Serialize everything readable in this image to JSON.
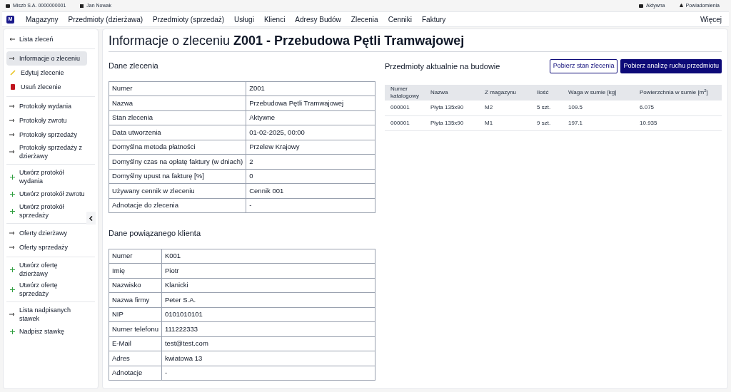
{
  "top_bar": {
    "company": "Miszb S.A. 0000000001",
    "user": "Jan Nowak",
    "status": "Aktywna",
    "notifications": "Powiadomienia"
  },
  "nav": {
    "logo": "M",
    "items": [
      "Magazyny",
      "Przedmioty (dzierżawa)",
      "Przedmioty (sprzedaż)",
      "Usługi",
      "Klienci",
      "Adresy Budów",
      "Zlecenia",
      "Cenniki",
      "Faktury"
    ],
    "more": "Więcej"
  },
  "sidebar": {
    "groups": [
      [
        {
          "kind": "back",
          "label": "Lista zleceń",
          "selected": false
        }
      ],
      [
        {
          "kind": "link",
          "label": "Informacje o zleceniu",
          "selected": true
        },
        {
          "kind": "edit",
          "label": "Edytuj zlecenie",
          "selected": false
        },
        {
          "kind": "delete",
          "label": "Usuń zlecenie",
          "selected": false
        }
      ],
      [
        {
          "kind": "link",
          "label": "Protokoły wydania",
          "selected": false
        },
        {
          "kind": "link",
          "label": "Protokoły zwrotu",
          "selected": false
        },
        {
          "kind": "link",
          "label": "Protokoły sprzedaży",
          "selected": false
        },
        {
          "kind": "link",
          "label": "Protokoły sprzedaży z dzierżawy",
          "selected": false
        }
      ],
      [
        {
          "kind": "add",
          "label": "Utwórz protokół wydania",
          "selected": false
        },
        {
          "kind": "add",
          "label": "Utwórz protokół zwrotu",
          "selected": false
        },
        {
          "kind": "add",
          "label": "Utwórz protokół sprzedaży",
          "selected": false
        }
      ],
      [
        {
          "kind": "link",
          "label": "Oferty dzierżawy",
          "selected": false
        },
        {
          "kind": "link",
          "label": "Oferty sprzedaży",
          "selected": false
        }
      ],
      [
        {
          "kind": "add",
          "label": "Utwórz ofertę dzierżawy",
          "selected": false
        },
        {
          "kind": "add",
          "label": "Utwórz ofertę sprzedaży",
          "selected": false
        }
      ],
      [
        {
          "kind": "link",
          "label": "Lista nadpisanych stawek",
          "selected": false
        },
        {
          "kind": "add",
          "label": "Nadpisz stawkę",
          "selected": false
        }
      ]
    ]
  },
  "title": {
    "prefix": "Informacje o zleceniu ",
    "code": "Z001 - Przebudowa Pętli Tramwajowej"
  },
  "order": {
    "heading": "Dane zlecenia",
    "rows": [
      [
        "Numer",
        "Z001"
      ],
      [
        "Nazwa",
        "Przebudowa Pętli Tramwajowej"
      ],
      [
        "Stan zlecenia",
        "Aktywne"
      ],
      [
        "Data utworzenia",
        "01-02-2025, 00:00"
      ],
      [
        "Domyślna metoda płatności",
        "Przelew Krajowy"
      ],
      [
        "Domyślny czas na opłatę faktury (w dniach)",
        "2"
      ],
      [
        "Domyślny upust na fakturę [%]",
        "0"
      ],
      [
        "Używany cennik w zleceniu",
        "Cennik 001"
      ],
      [
        "Adnotacje do zlecenia",
        "-"
      ]
    ]
  },
  "client": {
    "heading": "Dane powiązanego klienta",
    "rows": [
      [
        "Numer",
        "K001"
      ],
      [
        "Imię",
        "Piotr"
      ],
      [
        "Nazwisko",
        "Klanicki"
      ],
      [
        "Nazwa firmy",
        "Peter S.A."
      ],
      [
        "NIP",
        "0101010101"
      ],
      [
        "Numer telefonu",
        "111222333"
      ],
      [
        "E-Mail",
        "test@test.com"
      ],
      [
        "Adres",
        "kwiatowa 13"
      ],
      [
        "Adnotacje",
        "-"
      ]
    ]
  },
  "items": {
    "heading": "Przedmioty aktualnie na budowie",
    "buttons": [
      {
        "label": "Pobierz stan zlecenia",
        "kind": "outline"
      },
      {
        "label": "Pobierz analizę ruchu przedmiotu",
        "kind": "primary"
      }
    ],
    "columns": [
      "Numer katalogowy",
      "Nazwa",
      "Z magazynu",
      "Ilość",
      "Waga w sumie [kg]",
      "Powierzchnia w sumie [m$^{2}$]"
    ],
    "rows": [
      [
        "000001",
        "Płyta 135x90",
        "M2",
        "5 szt.",
        "109.5",
        "6.075"
      ],
      [
        "000001",
        "Płyta 135x90",
        "M1",
        "9 szt.",
        "197.1",
        "10.935"
      ]
    ]
  }
}
